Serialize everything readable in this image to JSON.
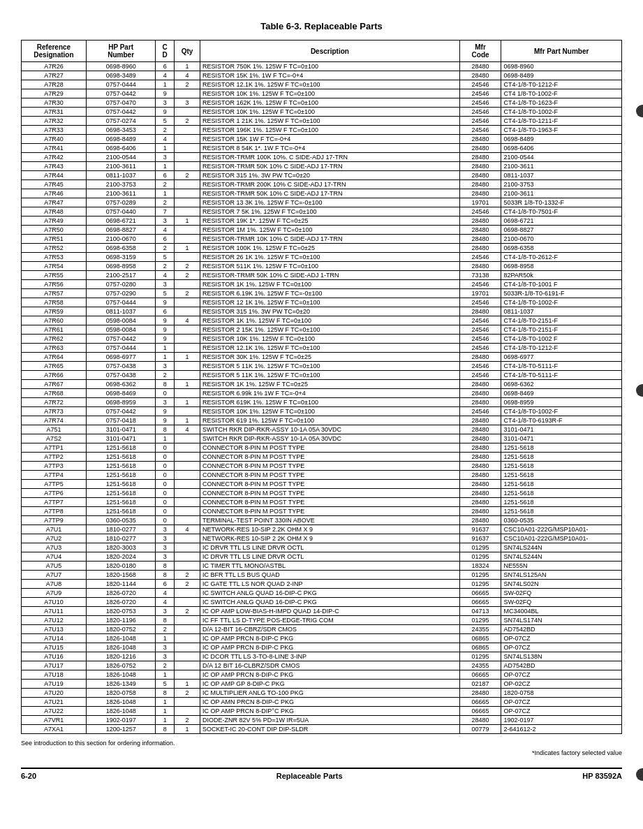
{
  "page": {
    "title": "Table 6-3.    Replaceable Parts",
    "footer_note": "*Indicates factory selected value",
    "footer_see": "See introduction to this section for ordering information.",
    "footer_section": "6-20",
    "footer_label": "Replaceable Parts",
    "footer_model": "HP 83592A"
  },
  "headers": {
    "ref_desig": "Reference\nDesignation",
    "hp_part": "HP Part\nNumber",
    "cd": "C\nD",
    "qty": "Qty",
    "description": "Description",
    "mfr_code": "Mfr\nCode",
    "mfr_part": "Mfr Part Number"
  },
  "rows": [
    {
      "ref": "A7R26",
      "hp": "0698-8960",
      "c": "6",
      "qty": "1",
      "desc": "RESISTOR 750K 1%. 125W F TC=0±100",
      "mfr": "28480",
      "mfrpart": "0698-8960"
    },
    {
      "ref": "A7R27",
      "hp": "0698-3489",
      "c": "4",
      "qty": "4",
      "desc": "RESISTOR 15K 1%. 1W F TC=-0+4",
      "mfr": "28480",
      "mfrpart": "0698-8489"
    },
    {
      "ref": "A7R28",
      "hp": "0757-0444",
      "c": "1",
      "qty": "2",
      "desc": "RESISTOR 12.1K 1%. 125W F TC=0±100",
      "mfr": "24546",
      "mfrpart": "CT4-1/8-T0-1212-F"
    },
    {
      "ref": "A7R29",
      "hp": "0757-0442",
      "c": "9",
      "qty": "",
      "desc": "RESISTOR 10K 1%. 125W F TC=0±100",
      "mfr": "24546",
      "mfrpart": "CT4 1/8-T0-1002-F"
    },
    {
      "ref": "A7R30",
      "hp": "0757-0470",
      "c": "3",
      "qty": "3",
      "desc": "RESISTOR 162K 1%. 125W F TC=0±100",
      "mfr": "24546",
      "mfrpart": "CT4-1/8-T0-1623-F"
    },
    {
      "ref": "A7R31",
      "hp": "0757-0442",
      "c": "9",
      "qty": "",
      "desc": "RESISTOR 10K 1%. 125W F TC=0±100",
      "mfr": "24546",
      "mfrpart": "CT4-1/8-T0-1002-F"
    },
    {
      "ref": "A7R32",
      "hp": "0757-0274",
      "c": "5",
      "qty": "2",
      "desc": "RESISTOR 1 21K 1%. 125W F TC=0±100",
      "mfr": "24546",
      "mfrpart": "CT4-1/8-T0-1211-F"
    },
    {
      "ref": "A7R33",
      "hp": "0698-3453",
      "c": "2",
      "qty": "",
      "desc": "RESISTOR 196K 1%. 125W F TC=0±100",
      "mfr": "24546",
      "mfrpart": "CT4-1/8-T0-1963-F"
    },
    {
      "ref": "A7R40",
      "hp": "0698-8489",
      "c": "4",
      "qty": "",
      "desc": "RESISTOR 15K 1W F TC=-0+4",
      "mfr": "28480",
      "mfrpart": "0698-8489"
    },
    {
      "ref": "A7R41",
      "hp": "0698-6406",
      "c": "1",
      "qty": "",
      "desc": "RESISTOR 8 54K 1*. 1W F TC=-0+4",
      "mfr": "28480",
      "mfrpart": "0698-6406"
    },
    {
      "ref": "A7R42",
      "hp": "2100-0544",
      "c": "3",
      "qty": "",
      "desc": "RESISTOR-TRMR 100K 10%. C SIDE-ADJ 17-TRN",
      "mfr": "28480",
      "mfrpart": "2100-0544"
    },
    {
      "ref": "A7R43",
      "hp": "2100-3611",
      "c": "1",
      "qty": "",
      "desc": "RESISTOR-TRMR 50K 10% C SIDE-ADJ 17-TRN",
      "mfr": "28480",
      "mfrpart": "2100-3611"
    },
    {
      "ref": "A7R44",
      "hp": "0811-1037",
      "c": "6",
      "qty": "2",
      "desc": "RESISTOR 315 1%. 3W PW TC=0±20",
      "mfr": "28480",
      "mfrpart": "0811-1037"
    },
    {
      "ref": "A7R45",
      "hp": "2100-3753",
      "c": "2",
      "qty": "",
      "desc": "RESISTOR-TRMR 200K 10% C SIDE-ADJ 17-TRN",
      "mfr": "28480",
      "mfrpart": "2100-3753"
    },
    {
      "ref": "A7R46",
      "hp": "2100-3611",
      "c": "1",
      "qty": "",
      "desc": "RESISTOR-TRMR 50K 10% C SIDE-ADJ 17-TRN",
      "mfr": "28480",
      "mfrpart": "2100-3611"
    },
    {
      "ref": "A7R47",
      "hp": "0757-0289",
      "c": "2",
      "qty": "",
      "desc": "RESISTOR 13 3K 1%. 125W F TC=-0±100",
      "mfr": "19701",
      "mfrpart": "5033R 1/8-T0-1332-F"
    },
    {
      "ref": "A7R48",
      "hp": "0757-0440",
      "c": "7",
      "qty": "",
      "desc": "RESISTOR 7 5K 1%. 125W F TC=0±100",
      "mfr": "24546",
      "mfrpart": "CT4-1/8-T0-7501-F"
    },
    {
      "ref": "A7R49",
      "hp": "0698-6721",
      "c": "3",
      "qty": "1",
      "desc": "RESISTOR 19K 1*. 125W F TC=0±25",
      "mfr": "28480",
      "mfrpart": "0698-6721"
    },
    {
      "ref": "A7R50",
      "hp": "0698-8827",
      "c": "4",
      "qty": "",
      "desc": "RESISTOR 1M 1%. 125W F TC=0±100",
      "mfr": "28480",
      "mfrpart": "0698-8827"
    },
    {
      "ref": "A7R51",
      "hp": "2100-0670",
      "c": "6",
      "qty": "",
      "desc": "RESISTOR-TRMR 10K 10% C SIDE-ADJ 17-TRN",
      "mfr": "28480",
      "mfrpart": "2100-0670"
    },
    {
      "ref": "A7R52",
      "hp": "0698-6358",
      "c": "2",
      "qty": "1",
      "desc": "RESISTOR 100K 1%. 125W F TC=0±25",
      "mfr": "28480",
      "mfrpart": "0698-6358"
    },
    {
      "ref": "A7R53",
      "hp": "0698-3159",
      "c": "5",
      "qty": "",
      "desc": "RESISTOR 26 1K 1%. 125W F TC=0±100",
      "mfr": "24546",
      "mfrpart": "CT4-1/8-T0-2612-F"
    },
    {
      "ref": "A7R54",
      "hp": "0698-8958",
      "c": "2",
      "qty": "2",
      "desc": "RESISTOR 511K 1%. 125W F TC=0±100",
      "mfr": "28480",
      "mfrpart": "0698-8958"
    },
    {
      "ref": "A7R55",
      "hp": "2100-2517",
      "c": "4",
      "qty": "2",
      "desc": "RESISTOR-TRMR 50K 10% C SIDE-ADJ 1-TRN",
      "mfr": "73138",
      "mfrpart": "82PAR50k"
    },
    {
      "ref": "A7R56",
      "hp": "0757-0280",
      "c": "3",
      "qty": "",
      "desc": "RESISTOR 1K 1%. 125W F TC=0±100",
      "mfr": "24546",
      "mfrpart": "CT4-1/8-T0-1001 F"
    },
    {
      "ref": "A7R57",
      "hp": "0757-0290",
      "c": "5",
      "qty": "2",
      "desc": "RESISTOR 6.19K 1%. 125W F TC=-0±100",
      "mfr": "19701",
      "mfrpart": "5033R-1/8-T0-6191-F"
    },
    {
      "ref": "A7R58",
      "hp": "0757-0444",
      "c": "9",
      "qty": "",
      "desc": "RESISTOR 12 1K 1%. 125W F TC=0±100",
      "mfr": "24546",
      "mfrpart": "CT4-1/8-T0-1002-F"
    },
    {
      "ref": "A7R59",
      "hp": "0811-1037",
      "c": "6",
      "qty": "",
      "desc": "RESISTOR 315 1%. 3W PW TC=0±20",
      "mfr": "28480",
      "mfrpart": "0811-1037"
    },
    {
      "ref": "A7R60",
      "hp": "0598-0084",
      "c": "9",
      "qty": "4",
      "desc": "RESISTOR 1K 1%. 125W F TC=0±100",
      "mfr": "24546",
      "mfrpart": "CT4-1/8-T0-2151-F"
    },
    {
      "ref": "A7R61",
      "hp": "0598-0084",
      "c": "9",
      "qty": "",
      "desc": "RESISTOR 2 15K 1%. 125W F TC=0±100",
      "mfr": "24546",
      "mfrpart": "CT4-1/8-T0-2151-F"
    },
    {
      "ref": "A7R62",
      "hp": "0757-0442",
      "c": "9",
      "qty": "",
      "desc": "RESISTOR 10K 1%. 125W F TC=0±100",
      "mfr": "24546",
      "mfrpart": "CT4-1/8-T0-1002 F"
    },
    {
      "ref": "A7R63",
      "hp": "0757-0444",
      "c": "1",
      "qty": "",
      "desc": "RESISTOR 12.1K 1%. 125W F TC=0±100",
      "mfr": "24546",
      "mfrpart": "CT4-1/8-T0-1212-F"
    },
    {
      "ref": "A7R64",
      "hp": "0698-6977",
      "c": "1",
      "qty": "1",
      "desc": "RESISTOR 30K 1%. 125W F TC=0±25",
      "mfr": "28480",
      "mfrpart": "0698-6977"
    },
    {
      "ref": "A7R65",
      "hp": "0757-0438",
      "c": "3",
      "qty": "",
      "desc": "RESISTOR 5 11K 1%. 125W F TC=0±100",
      "mfr": "24546",
      "mfrpart": "CT4-1/8-T0-5111-F"
    },
    {
      "ref": "A7R66",
      "hp": "0757-0438",
      "c": "2",
      "qty": "",
      "desc": "RESISTOR 5 11K 1%. 125W F TC=0±100",
      "mfr": "24546",
      "mfrpart": "CT4-1/8-T0-5111-F"
    },
    {
      "ref": "A7R67",
      "hp": "0698-6362",
      "c": "8",
      "qty": "1",
      "desc": "RESISTOR 1K 1%. 125W F TC=0±25",
      "mfr": "28480",
      "mfrpart": "0698-6362"
    },
    {
      "ref": "A7R68",
      "hp": "0698-8469",
      "c": "0",
      "qty": "",
      "desc": "RESISTOR 6.99k 1% 1W F TC=-0+4",
      "mfr": "28480",
      "mfrpart": "0698-8469"
    },
    {
      "ref": "A7R72",
      "hp": "0698-8959",
      "c": "3",
      "qty": "1",
      "desc": "RESISTOR 619K 1%. 125W F TC=0±100",
      "mfr": "28480",
      "mfrpart": "0698-8959"
    },
    {
      "ref": "A7R73",
      "hp": "0757-0442",
      "c": "9",
      "qty": "",
      "desc": "RESISTOR 10K 1%. 125W F TC=0±100",
      "mfr": "24546",
      "mfrpart": "CT4-1/8-T0-1002-F"
    },
    {
      "ref": "A7R74",
      "hp": "0757-0418",
      "c": "9",
      "qty": "1",
      "desc": "RESISTOR 619 1%. 125W F TC=0±100",
      "mfr": "28480",
      "mfrpart": "CT4-1/8-T0-6193R-F"
    },
    {
      "ref": "A751",
      "hp": "3101-0471",
      "c": "8",
      "qty": "4",
      "desc": "SWITCH RKR DIP-RKR-ASSY 10-1A  05A 30VDC",
      "mfr": "28480",
      "mfrpart": "3101-0471"
    },
    {
      "ref": "A7S2",
      "hp": "3101-0471",
      "c": "1",
      "qty": "",
      "desc": "SWITCH RKR DIP-RKR-ASSY 10-1A  05A 30VDC",
      "mfr": "28480",
      "mfrpart": "3101-0471"
    },
    {
      "ref": "A7TP1",
      "hp": "1251-5618",
      "c": "0",
      "qty": "",
      "desc": "CONNECTOR 8-PIN M POST TYPE",
      "mfr": "28480",
      "mfrpart": "1251-5618"
    },
    {
      "ref": "A7TP2",
      "hp": "1251-5618",
      "c": "0",
      "qty": "",
      "desc": "CONNECTOR 8-PIN M POST TYPE",
      "mfr": "28480",
      "mfrpart": "1251-5618"
    },
    {
      "ref": "A7TP3",
      "hp": "1251-5618",
      "c": "0",
      "qty": "",
      "desc": "CONNECTOR 8-PIN M POST TYPE",
      "mfr": "28480",
      "mfrpart": "1251-5618"
    },
    {
      "ref": "A7TP4",
      "hp": "1251-5618",
      "c": "0",
      "qty": "",
      "desc": "CONNECTOR 8-PIN M POST TYPE",
      "mfr": "28480",
      "mfrpart": "1251-5618"
    },
    {
      "ref": "A7TP5",
      "hp": "1251-5618",
      "c": "0",
      "qty": "",
      "desc": "CONNECTOR 8-PIN M POST TYPE",
      "mfr": "28480",
      "mfrpart": "1251-5618"
    },
    {
      "ref": "A7TP6",
      "hp": "1251-5618",
      "c": "0",
      "qty": "",
      "desc": "CONNECTOR 8-PIN M POST TYPE",
      "mfr": "28480",
      "mfrpart": "1251-5618"
    },
    {
      "ref": "A7TP7",
      "hp": "1251-5618",
      "c": "0",
      "qty": "",
      "desc": "CONNECTOR 8-PIN M POST TYPE",
      "mfr": "28480",
      "mfrpart": "1251-5618"
    },
    {
      "ref": "A7TP8",
      "hp": "1251-5618",
      "c": "0",
      "qty": "",
      "desc": "CONNECTOR 8-PIN M POST TYPE",
      "mfr": "28480",
      "mfrpart": "1251-5618"
    },
    {
      "ref": "A7TP9",
      "hp": "0360-0535",
      "c": "0",
      "qty": "",
      "desc": "TERMINAL-TEST POINT  330IN ABOVE",
      "mfr": "28480",
      "mfrpart": "0360-0535"
    },
    {
      "ref": "A7U1",
      "hp": "1810-0277",
      "c": "3",
      "qty": "4",
      "desc": "NETWORK-RES 10-SIP 2.2K OHM X 9",
      "mfr": "91637",
      "mfrpart": "CSC10A01-222G/MSP10A01-"
    },
    {
      "ref": "A7U2",
      "hp": "1810-0277",
      "c": "3",
      "qty": "",
      "desc": "NETWORK-RES 10-SIP 2 2K OHM X 9",
      "mfr": "91637",
      "mfrpart": "CSC10A01-222G/MSP10A01-"
    },
    {
      "ref": "A7U3",
      "hp": "1820-3003",
      "c": "3",
      "qty": "",
      "desc": "IC DRVR TTL LS LINE DRVR OCTL",
      "mfr": "01295",
      "mfrpart": "SN74LS244N"
    },
    {
      "ref": "A7U4",
      "hp": "1820-2024",
      "c": "3",
      "qty": "",
      "desc": "IC DRVR TTL LS LINE DRVR OCTL",
      "mfr": "01295",
      "mfrpart": "SN74LS244N"
    },
    {
      "ref": "A7U5",
      "hp": "1820-0180",
      "c": "8",
      "qty": "",
      "desc": "IC TIMER TTL MONO/ASTBL",
      "mfr": "18324",
      "mfrpart": "NE555N"
    },
    {
      "ref": "A7U7",
      "hp": "1820-1568",
      "c": "8",
      "qty": "2",
      "desc": "IC BFR TTL LS BUS QUAD",
      "mfr": "01295",
      "mfrpart": "SN74LS125AN"
    },
    {
      "ref": "A7U8",
      "hp": "1820-1144",
      "c": "6",
      "qty": "2",
      "desc": "IC GATE TTL LS NOR QUAD 2-INP",
      "mfr": "01295",
      "mfrpart": "SN74LS02N"
    },
    {
      "ref": "A7U9",
      "hp": "1826-0720",
      "c": "4",
      "qty": "",
      "desc": "IC SWITCH ANLG QUAD 16-DIP-C PKG",
      "mfr": "06665",
      "mfrpart": "SW-02FQ"
    },
    {
      "ref": "A7U10",
      "hp": "1826-0720",
      "c": "4",
      "qty": "",
      "desc": "IC SWITCH ANLG QUAD 16-DIP-C PKG",
      "mfr": "06665",
      "mfrpart": "SW-02FQ"
    },
    {
      "ref": "A7U11",
      "hp": "1820-0753",
      "c": "3",
      "qty": "2",
      "desc": "IC OP AMP LOW-BIAS-H-IMPD QUAD 14-DIP-C",
      "mfr": "04713",
      "mfrpart": "MC34004BL"
    },
    {
      "ref": "A7U12",
      "hp": "1820-1196",
      "c": "8",
      "qty": "",
      "desc": "IC FF TTL LS D-TYPE POS-EDGE-TRIG COM",
      "mfr": "01295",
      "mfrpart": "SN74LS174N"
    },
    {
      "ref": "A7U13",
      "hp": "1820-0752",
      "c": "2",
      "qty": "",
      "desc": "D/A 12-BIT 16-CBRZ/SDR CMOS",
      "mfr": "24355",
      "mfrpart": "AD7542BD"
    },
    {
      "ref": "A7U14",
      "hp": "1826-1048",
      "c": "1",
      "qty": "",
      "desc": "IC OP AMP PRCN 8-DIP-C PKG",
      "mfr": "06865",
      "mfrpart": "OP-07CZ"
    },
    {
      "ref": "A7U15",
      "hp": "1826-1048",
      "c": "3",
      "qty": "",
      "desc": "IC OP AMP PRCN 8-DIP-C PKG",
      "mfr": "06865",
      "mfrpart": "OP-07CZ"
    },
    {
      "ref": "A7U16",
      "hp": "1820-1216",
      "c": "3",
      "qty": "",
      "desc": "IC DCOR TTL LS 3-TO-8-LINE 3-INP",
      "mfr": "01295",
      "mfrpart": "SN74LS138N"
    },
    {
      "ref": "A7U17",
      "hp": "1826-0752",
      "c": "2",
      "qty": "",
      "desc": "D/A 12 BIT 16-CLBRZ/SDR CMOS",
      "mfr": "24355",
      "mfrpart": "AD7542BD"
    },
    {
      "ref": "A7U18",
      "hp": "1826-1048",
      "c": "1",
      "qty": "",
      "desc": "IC OP AMP PRCN 8-DIP-C PKG",
      "mfr": "06665",
      "mfrpart": "OP-07CZ"
    },
    {
      "ref": "A7U19",
      "hp": "1826-1349",
      "c": "5",
      "qty": "1",
      "desc": "IC OP AMP GP 8-DIP-C PKG",
      "mfr": "02187",
      "mfrpart": "OP-02CZ"
    },
    {
      "ref": "A7U20",
      "hp": "1820-0758",
      "c": "8",
      "qty": "2",
      "desc": "IC MULTIPLIER ANLG TO-100 PKG",
      "mfr": "28480",
      "mfrpart": "1820-0758"
    },
    {
      "ref": "A7U21",
      "hp": "1826-1048",
      "c": "1",
      "qty": "",
      "desc": "IC OP AMN PRCN 8-DIP-C PKG",
      "mfr": "06665",
      "mfrpart": "OP-07CZ"
    },
    {
      "ref": "A7U22",
      "hp": "1826-1048",
      "c": "1",
      "qty": "",
      "desc": "IC OP AMP PRCN 8-DIP°C PKG",
      "mfr": "06665",
      "mfrpart": "OP-07CZ"
    },
    {
      "ref": "A7VR1",
      "hp": "1902-0197",
      "c": "1",
      "qty": "2",
      "desc": "DIODE-ZNR 82V 5% PD=1W IR=5UA",
      "mfr": "28480",
      "mfrpart": "1902-0197"
    },
    {
      "ref": "A7XA1",
      "hp": "1200-1257",
      "c": "8",
      "qty": "1",
      "desc": "SOCKET-IC 20-CONT DIP DIP-SLDR",
      "mfr": "00779",
      "mfrpart": "2-641612-2"
    }
  ]
}
